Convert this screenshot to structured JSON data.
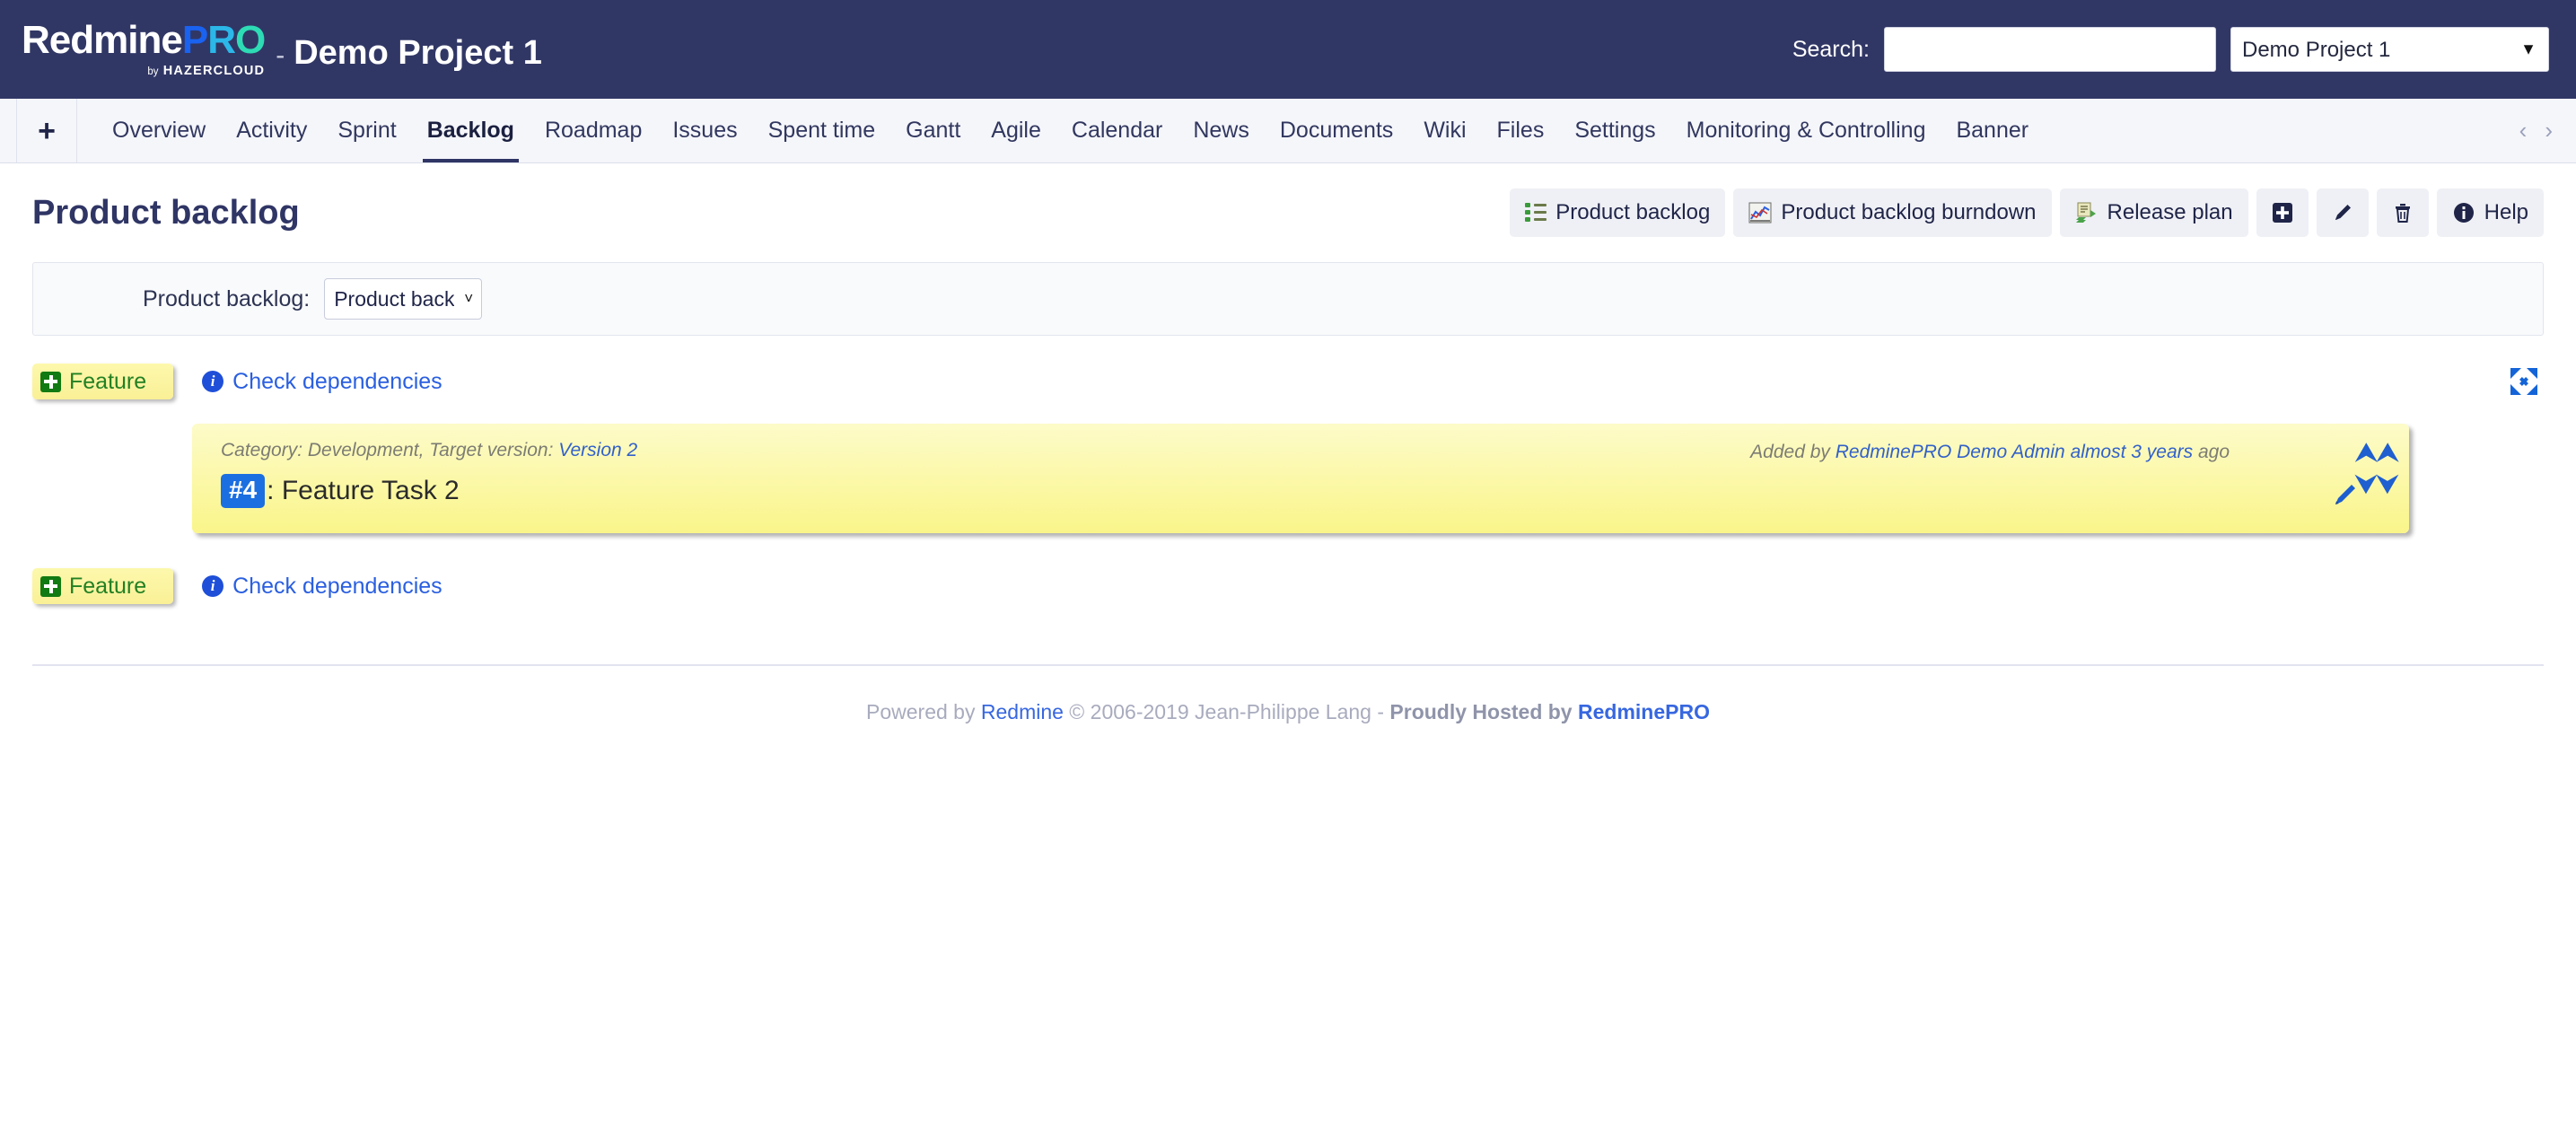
{
  "header": {
    "logo": {
      "red": "Redmine",
      "p": "P",
      "r": "R",
      "o": "O",
      "by": "by",
      "hazer": "HAZERCLOUD"
    },
    "dash": "-",
    "project_title": "Demo Project 1",
    "search_label": "Search:",
    "search_value": "",
    "search_placeholder": "",
    "project_selector": {
      "selected": "Demo Project 1",
      "options": [
        "Demo Project 1"
      ]
    }
  },
  "nav": {
    "add_label": "+",
    "tabs": [
      {
        "label": "Overview",
        "active": false
      },
      {
        "label": "Activity",
        "active": false
      },
      {
        "label": "Sprint",
        "active": false
      },
      {
        "label": "Backlog",
        "active": true
      },
      {
        "label": "Roadmap",
        "active": false
      },
      {
        "label": "Issues",
        "active": false
      },
      {
        "label": "Spent time",
        "active": false
      },
      {
        "label": "Gantt",
        "active": false
      },
      {
        "label": "Agile",
        "active": false
      },
      {
        "label": "Calendar",
        "active": false
      },
      {
        "label": "News",
        "active": false
      },
      {
        "label": "Documents",
        "active": false
      },
      {
        "label": "Wiki",
        "active": false
      },
      {
        "label": "Files",
        "active": false
      },
      {
        "label": "Settings",
        "active": false
      },
      {
        "label": "Monitoring & Controlling",
        "active": false
      },
      {
        "label": "Banner",
        "active": false
      }
    ],
    "prev_arrow": "‹",
    "next_arrow": "›"
  },
  "page": {
    "title": "Product backlog"
  },
  "toolbar": {
    "product_backlog_label": "Product backlog",
    "burndown_label": "Product backlog burndown",
    "release_plan_label": "Release plan",
    "help_label": "Help"
  },
  "filter": {
    "label": "Product backlog:",
    "selected": "Product backlog",
    "options": [
      "Product backlog"
    ]
  },
  "backlog": {
    "rows": [
      {
        "badge": "Feature",
        "check_dependencies": "Check dependencies"
      },
      {
        "badge": "Feature",
        "check_dependencies": "Check dependencies"
      }
    ],
    "card": {
      "meta": "Category: Development, Target version: ",
      "meta_link": "Version 2",
      "added_prefix": "Added by ",
      "added_author": "RedminePRO Demo Admin almost 3 years",
      "added_suffix": " ago",
      "issue_id": "#4",
      "separator": ":",
      "subject": "Feature Task 2"
    }
  },
  "footer": {
    "powered_by": "Powered by ",
    "redmine": "Redmine",
    "copyright": " © 2006-2019 Jean-Philippe Lang - ",
    "hosted": "Proudly Hosted by ",
    "host": "RedminePRO"
  },
  "colors": {
    "header_bg": "#313765",
    "nav_bg": "#f5f6fa",
    "accent_blue": "#2a5fe0",
    "badge_green": "#238023",
    "card_yellow": "#faf58a",
    "issue_id_blue": "#1c6fe0"
  }
}
